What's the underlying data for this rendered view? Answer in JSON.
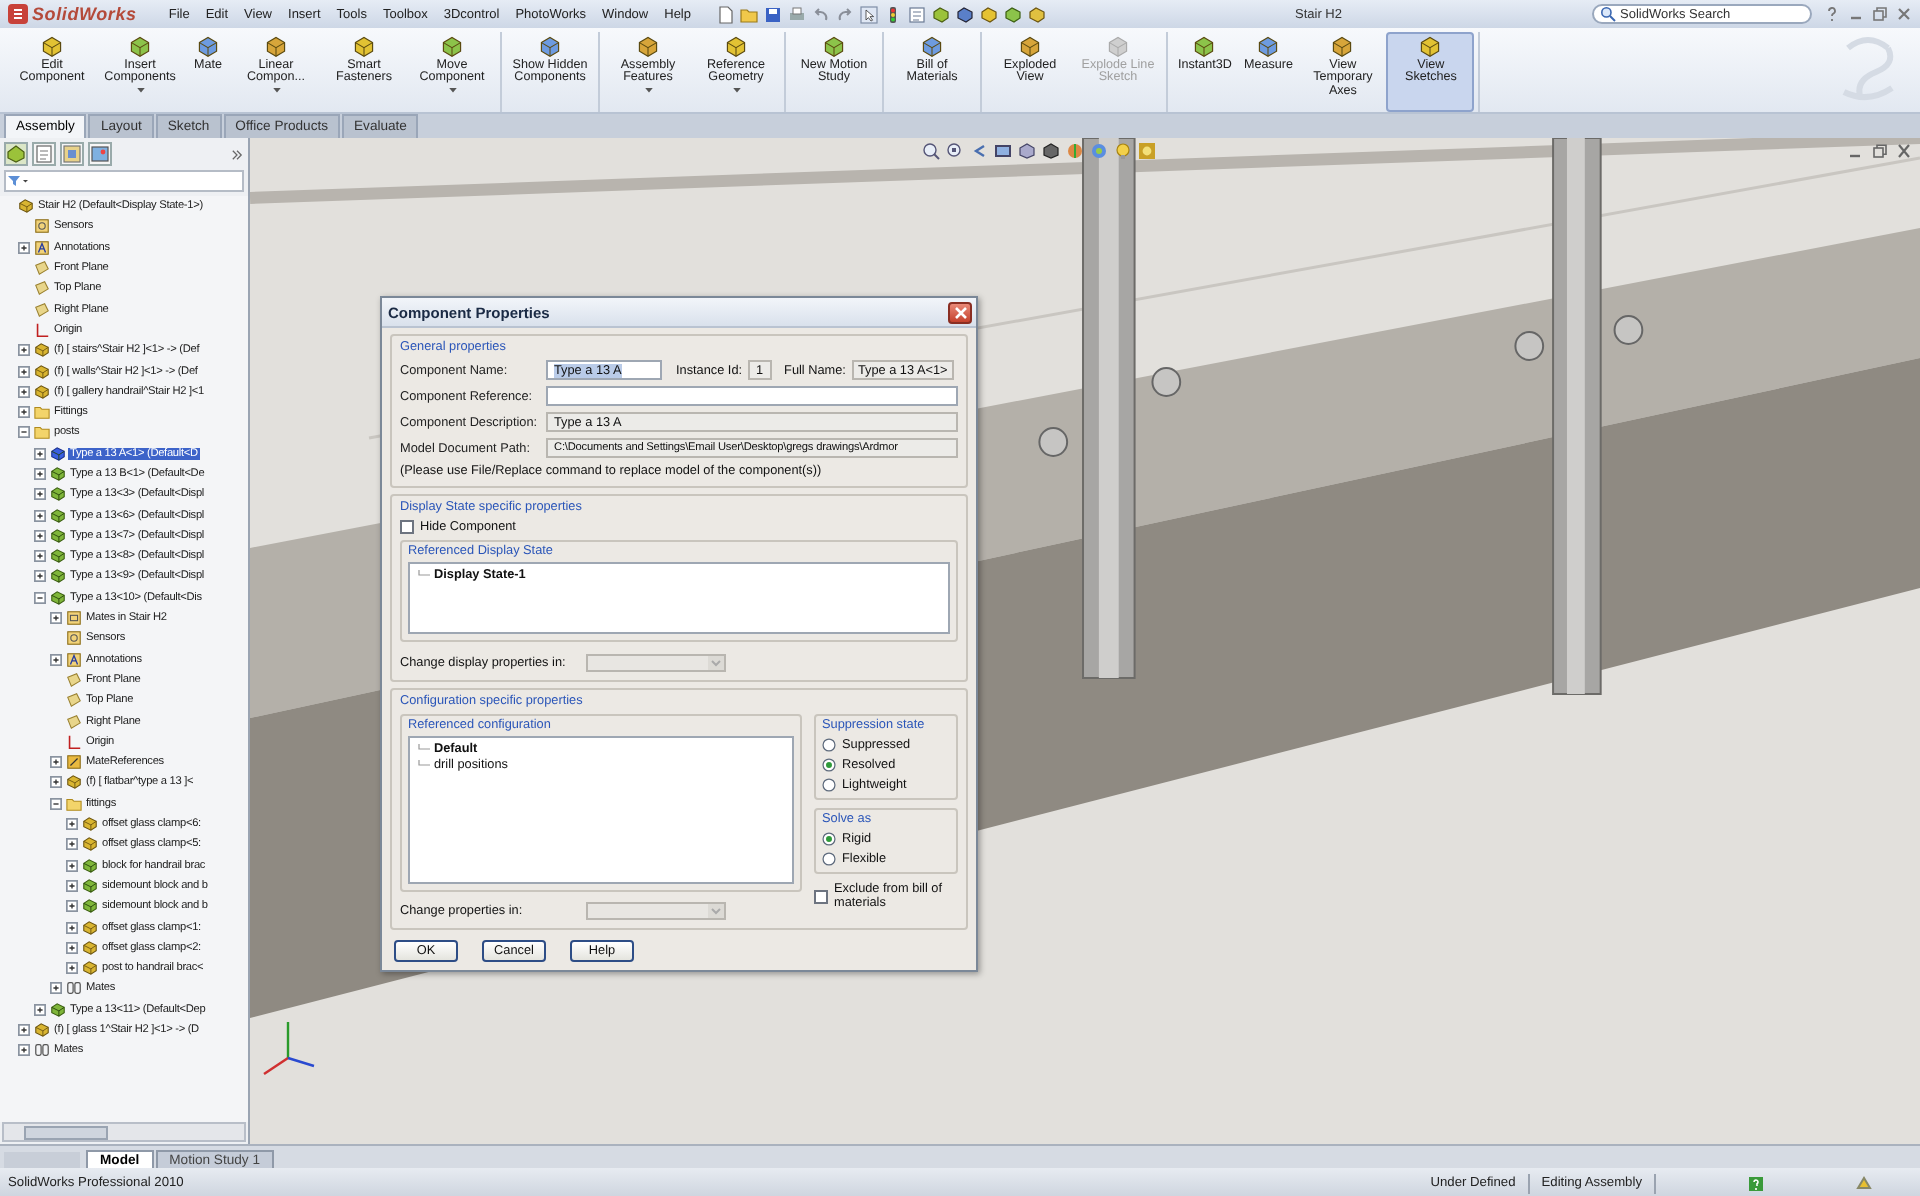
{
  "app": {
    "logo": "SolidWorks",
    "menus": [
      "File",
      "Edit",
      "View",
      "Insert",
      "Tools",
      "Toolbox",
      "3Dcontrol",
      "PhotoWorks",
      "Window",
      "Help"
    ],
    "document_title": "Stair H2",
    "search": {
      "placeholder": "SolidWorks Search"
    }
  },
  "ribbon": {
    "groups": [
      [
        {
          "label": "Edit Component",
          "dropdown": false,
          "pressed": false,
          "disabled": false
        },
        {
          "label": "Insert Components",
          "dropdown": true,
          "pressed": false,
          "disabled": false
        },
        {
          "label": "Mate",
          "dropdown": false,
          "pressed": false,
          "disabled": false
        },
        {
          "label": "Linear Compon...",
          "dropdown": true,
          "pressed": false,
          "disabled": false
        },
        {
          "label": "Smart Fasteners",
          "dropdown": false,
          "pressed": false,
          "disabled": false
        },
        {
          "label": "Move Component",
          "dropdown": true,
          "pressed": false,
          "disabled": false
        }
      ],
      [
        {
          "label": "Show Hidden Components",
          "dropdown": false,
          "pressed": false,
          "disabled": false
        }
      ],
      [
        {
          "label": "Assembly Features",
          "dropdown": true,
          "pressed": false,
          "disabled": false
        },
        {
          "label": "Reference Geometry",
          "dropdown": true,
          "pressed": false,
          "disabled": false
        }
      ],
      [
        {
          "label": "New Motion Study",
          "dropdown": false,
          "pressed": false,
          "disabled": false
        }
      ],
      [
        {
          "label": "Bill of Materials",
          "dropdown": false,
          "pressed": false,
          "disabled": false
        }
      ],
      [
        {
          "label": "Exploded View",
          "dropdown": false,
          "pressed": false,
          "disabled": false
        },
        {
          "label": "Explode Line Sketch",
          "dropdown": false,
          "pressed": false,
          "disabled": true
        }
      ],
      [
        {
          "label": "Instant3D",
          "dropdown": false,
          "pressed": false,
          "disabled": false
        },
        {
          "label": "Measure",
          "dropdown": false,
          "pressed": false,
          "disabled": false
        },
        {
          "label": "View Temporary Axes",
          "dropdown": false,
          "pressed": false,
          "disabled": false
        },
        {
          "label": "View Sketches",
          "dropdown": false,
          "pressed": true,
          "disabled": false
        }
      ]
    ]
  },
  "command_tabs": [
    {
      "label": "Assembly",
      "selected": true
    },
    {
      "label": "Layout",
      "selected": false
    },
    {
      "label": "Sketch",
      "selected": false
    },
    {
      "label": "Office Products",
      "selected": false
    },
    {
      "label": "Evaluate",
      "selected": false
    }
  ],
  "tree": {
    "items": [
      {
        "label": "Stair H2  (Default<Display State-1>)",
        "kind": "assembly",
        "selected": false,
        "children": [
          {
            "label": "Sensors",
            "kind": "sensor",
            "selected": false
          },
          {
            "label": "Annotations",
            "kind": "annotation",
            "selected": false,
            "expanded": false
          },
          {
            "label": "Front Plane",
            "kind": "plane",
            "selected": false
          },
          {
            "label": "Top Plane",
            "kind": "plane",
            "selected": false
          },
          {
            "label": "Right Plane",
            "kind": "plane",
            "selected": false
          },
          {
            "label": "Origin",
            "kind": "origin",
            "selected": false
          },
          {
            "label": "(f) [ stairs^Stair H2 ]<1> -> (Def",
            "kind": "assembly",
            "selected": false,
            "expanded": false
          },
          {
            "label": "(f) [ walls^Stair H2 ]<1> -> (Def",
            "kind": "assembly",
            "selected": false,
            "expanded": false
          },
          {
            "label": "(f) [ gallery handrail^Stair H2 ]<1",
            "kind": "assembly",
            "selected": false,
            "expanded": false
          },
          {
            "label": "Fittings",
            "kind": "folder",
            "selected": false,
            "expanded": false
          },
          {
            "label": "posts",
            "kind": "folder",
            "selected": false,
            "expanded": true,
            "children": [
              {
                "label": "Type a 13 A<1> (Default<D",
                "kind": "part",
                "selected": true,
                "expanded": false
              },
              {
                "label": "Type a 13 B<1> (Default<De",
                "kind": "part",
                "selected": false,
                "expanded": false
              },
              {
                "label": "Type a 13<3> (Default<Displ",
                "kind": "part",
                "selected": false,
                "expanded": false
              },
              {
                "label": "Type a 13<6> (Default<Displ",
                "kind": "part",
                "selected": false,
                "expanded": false
              },
              {
                "label": "Type a 13<7> (Default<Displ",
                "kind": "part",
                "selected": false,
                "expanded": false
              },
              {
                "label": "Type a 13<8> (Default<Displ",
                "kind": "part",
                "selected": false,
                "expanded": false
              },
              {
                "label": "Type a 13<9> (Default<Displ",
                "kind": "part",
                "selected": false,
                "expanded": false
              },
              {
                "label": "Type a 13<10> (Default<Dis",
                "kind": "part",
                "selected": false,
                "expanded": true,
                "children": [
                  {
                    "label": "Mates in Stair H2",
                    "kind": "mates_in",
                    "selected": false,
                    "expanded": false
                  },
                  {
                    "label": "Sensors",
                    "kind": "sensor",
                    "selected": false
                  },
                  {
                    "label": "Annotations",
                    "kind": "annotation",
                    "selected": false,
                    "expanded": false
                  },
                  {
                    "label": "Front Plane",
                    "kind": "plane",
                    "selected": false
                  },
                  {
                    "label": "Top Plane",
                    "kind": "plane",
                    "selected": false
                  },
                  {
                    "label": "Right Plane",
                    "kind": "plane",
                    "selected": false
                  },
                  {
                    "label": "Origin",
                    "kind": "origin",
                    "selected": false
                  },
                  {
                    "label": "MateReferences",
                    "kind": "mate_references",
                    "selected": false,
                    "expanded": false
                  },
                  {
                    "label": "(f) [ flatbar^type a 13 ]<",
                    "kind": "assembly",
                    "selected": false,
                    "expanded": false
                  },
                  {
                    "label": "fittings",
                    "kind": "folder",
                    "selected": false,
                    "expanded": true,
                    "children": [
                      {
                        "label": "offset glass clamp<6:",
                        "kind": "assembly",
                        "selected": false,
                        "expanded": false
                      },
                      {
                        "label": "offset glass clamp<5:",
                        "kind": "assembly",
                        "selected": false,
                        "expanded": false
                      },
                      {
                        "label": "block for handrail brac",
                        "kind": "part",
                        "selected": false,
                        "expanded": false
                      },
                      {
                        "label": "sidemount block and b",
                        "kind": "part",
                        "selected": false,
                        "expanded": false
                      },
                      {
                        "label": "sidemount block and b",
                        "kind": "part",
                        "selected": false,
                        "expanded": false
                      },
                      {
                        "label": "offset glass clamp<1:",
                        "kind": "assembly",
                        "selected": false,
                        "expanded": false
                      },
                      {
                        "label": "offset glass clamp<2:",
                        "kind": "assembly",
                        "selected": false,
                        "expanded": false
                      },
                      {
                        "label": "post to handrail brac<",
                        "kind": "assembly",
                        "selected": false,
                        "expanded": false
                      }
                    ]
                  },
                  {
                    "label": "Mates",
                    "kind": "mates",
                    "selected": false,
                    "expanded": false
                  }
                ]
              },
              {
                "label": "Type a 13<11> (Default<Dep",
                "kind": "part",
                "selected": false,
                "expanded": false
              }
            ]
          },
          {
            "label": "(f) [ glass 1^Stair H2 ]<1> -> (D",
            "kind": "assembly",
            "selected": false,
            "expanded": false
          },
          {
            "label": "Mates",
            "kind": "mates",
            "selected": false,
            "expanded": false
          }
        ]
      }
    ]
  },
  "dialog": {
    "title": "Component Properties",
    "general": {
      "heading": "General properties",
      "name": {
        "label": "Component Name:",
        "value": "Type a 13 A",
        "highlighted": true
      },
      "instance": {
        "label": "Instance Id:",
        "value": "1"
      },
      "full_name": {
        "label": "Full Name:",
        "value": "Type a 13 A<1>"
      },
      "fields": [
        {
          "label": "Component Reference:",
          "readonly": false
        },
        {
          "label": "Component Description:",
          "value": "Type a 13 A",
          "readonly": true
        },
        {
          "label": "Model Document Path:",
          "value": "C:\\Documents and Settings\\Email User\\Desktop\\gregs drawings\\Ardmor",
          "readonly": true
        }
      ],
      "note": "(Please use File/Replace command to replace model of the component(s))"
    },
    "display_state": {
      "heading": "Display State specific properties",
      "hide_component": {
        "label": "Hide Component",
        "checked": false
      },
      "list_heading": "Referenced Display State",
      "items": [
        {
          "label": "Display State-1",
          "selected": true
        }
      ],
      "change_label": "Change display properties in:",
      "change_disabled": true
    },
    "configuration": {
      "heading": "Configuration specific properties",
      "list_heading": "Referenced configuration",
      "items": [
        {
          "label": "Default",
          "selected": true
        },
        {
          "label": "drill positions",
          "selected": false
        }
      ],
      "change_label": "Change properties in:",
      "change_disabled": true,
      "suppression": {
        "heading": "Suppression state",
        "options": [
          {
            "label": "Suppressed",
            "selected": false
          },
          {
            "label": "Resolved",
            "selected": true
          },
          {
            "label": "Lightweight",
            "selected": false
          }
        ]
      },
      "solve_as": {
        "heading": "Solve as",
        "options": [
          {
            "label": "Rigid",
            "selected": true
          },
          {
            "label": "Flexible",
            "selected": false
          }
        ]
      },
      "exclude_bom": {
        "label": "Exclude from bill of materials",
        "checked": false
      }
    },
    "buttons": [
      "OK",
      "Cancel",
      "Help"
    ]
  },
  "bottom_tabs": [
    {
      "label": "Model",
      "selected": true
    },
    {
      "label": "Motion Study 1",
      "selected": false
    }
  ],
  "status_bar": {
    "product": "SolidWorks Professional 2010",
    "state": "Under Defined",
    "mode": "Editing Assembly"
  }
}
